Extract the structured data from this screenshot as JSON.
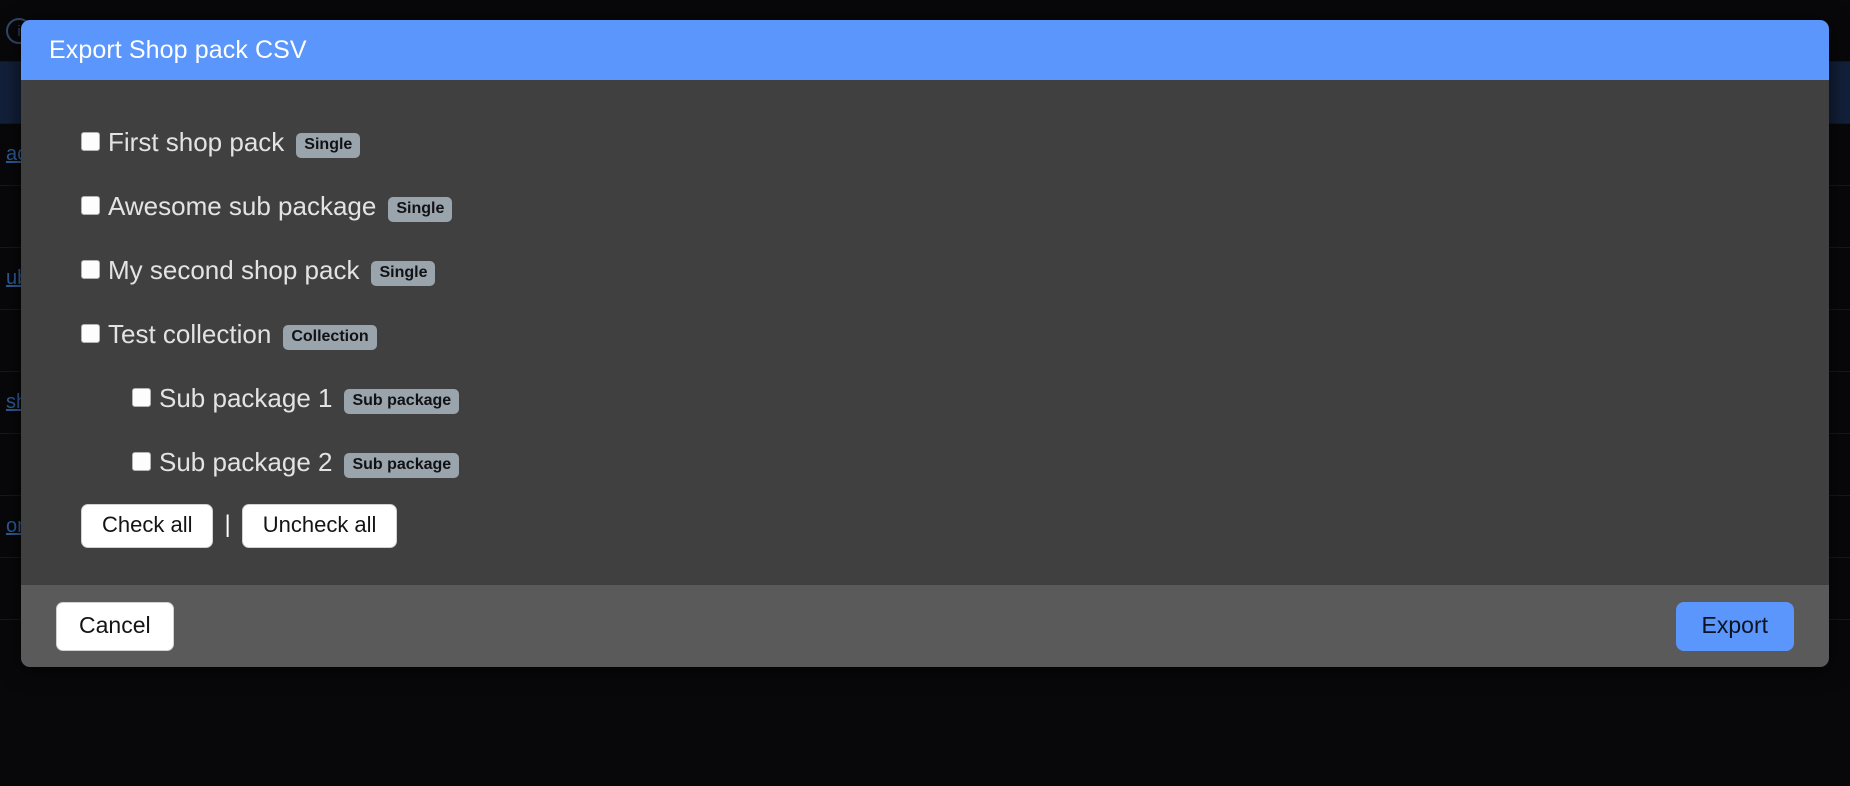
{
  "modal": {
    "title": "Export Shop pack CSV",
    "header_color": "#5a96fb",
    "body_color": "#404041",
    "footer_color": "#5a5a5a",
    "packs": [
      {
        "label": "First shop pack",
        "badge": "Single",
        "checked": false,
        "indent": false
      },
      {
        "label": "Awesome sub package",
        "badge": "Single",
        "checked": false,
        "indent": false
      },
      {
        "label": "My second shop pack",
        "badge": "Single",
        "checked": false,
        "indent": false
      },
      {
        "label": "Test collection",
        "badge": "Collection",
        "checked": false,
        "indent": false
      },
      {
        "label": "Sub package 1",
        "badge": "Sub package",
        "checked": false,
        "indent": true
      },
      {
        "label": "Sub package 2",
        "badge": "Sub package",
        "checked": false,
        "indent": true
      }
    ],
    "bulk": {
      "check_all_label": "Check all",
      "separator": "|",
      "uncheck_all_label": "Uncheck all"
    },
    "footer": {
      "cancel_label": "Cancel",
      "export_label": "Export",
      "export_color": "#5a96fb"
    }
  },
  "background": {
    "rows": [
      {
        "text": "",
        "highlight": false,
        "icon": "info-circle-icon",
        "caret": false
      },
      {
        "text": "",
        "highlight": true,
        "icon": "",
        "caret": false
      },
      {
        "text": "ac",
        "highlight": false,
        "icon": "",
        "caret": true
      },
      {
        "text": "",
        "highlight": false,
        "icon": "",
        "caret": false
      },
      {
        "text": "ub",
        "highlight": false,
        "icon": "",
        "caret": true
      },
      {
        "text": "",
        "highlight": false,
        "icon": "",
        "caret": false
      },
      {
        "text": "sh",
        "highlight": false,
        "icon": "",
        "caret": true
      },
      {
        "text": "",
        "highlight": false,
        "icon": "",
        "caret": false
      },
      {
        "text": "on",
        "highlight": false,
        "icon": "",
        "caret": true
      },
      {
        "text": "",
        "highlight": false,
        "icon": "",
        "caret": false
      }
    ]
  }
}
